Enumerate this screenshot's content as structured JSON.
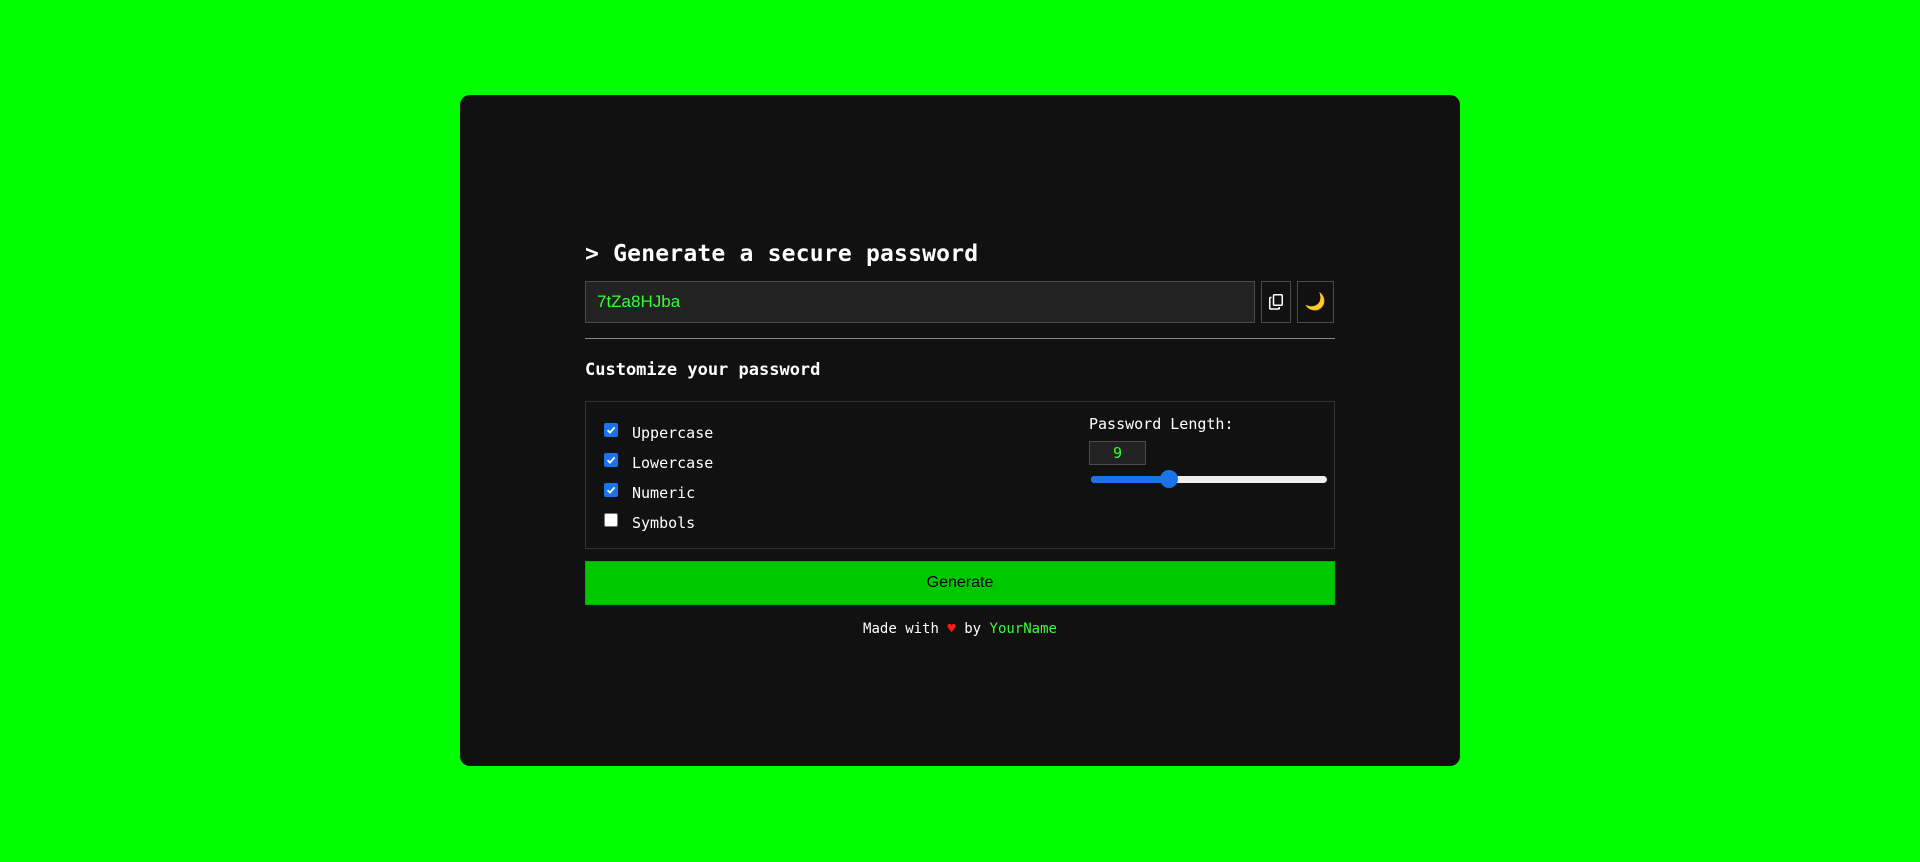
{
  "colors": {
    "background": "#00ff00",
    "card": "#111111",
    "accent": "#33ff33",
    "button": "#00c800",
    "checkbox": "#1a73e8",
    "heart": "#ff1a1a"
  },
  "header": {
    "title": "> Generate a secure password"
  },
  "password": {
    "value": "7tZa8HJba",
    "copy_icon": "copy-icon",
    "theme_icon": "moon-icon",
    "theme_glyph": "🌙"
  },
  "customize": {
    "title": "Customize your password",
    "options": [
      {
        "label": "Uppercase",
        "checked": true
      },
      {
        "label": "Lowercase",
        "checked": true
      },
      {
        "label": "Numeric",
        "checked": true
      },
      {
        "label": "Symbols",
        "checked": false
      }
    ],
    "length": {
      "label": "Password Length:",
      "value": "9",
      "slider_fraction": 0.33
    }
  },
  "actions": {
    "generate_label": "Generate"
  },
  "footer": {
    "prefix": "Made with",
    "heart": "♥",
    "by": "by",
    "author": "YourName"
  }
}
